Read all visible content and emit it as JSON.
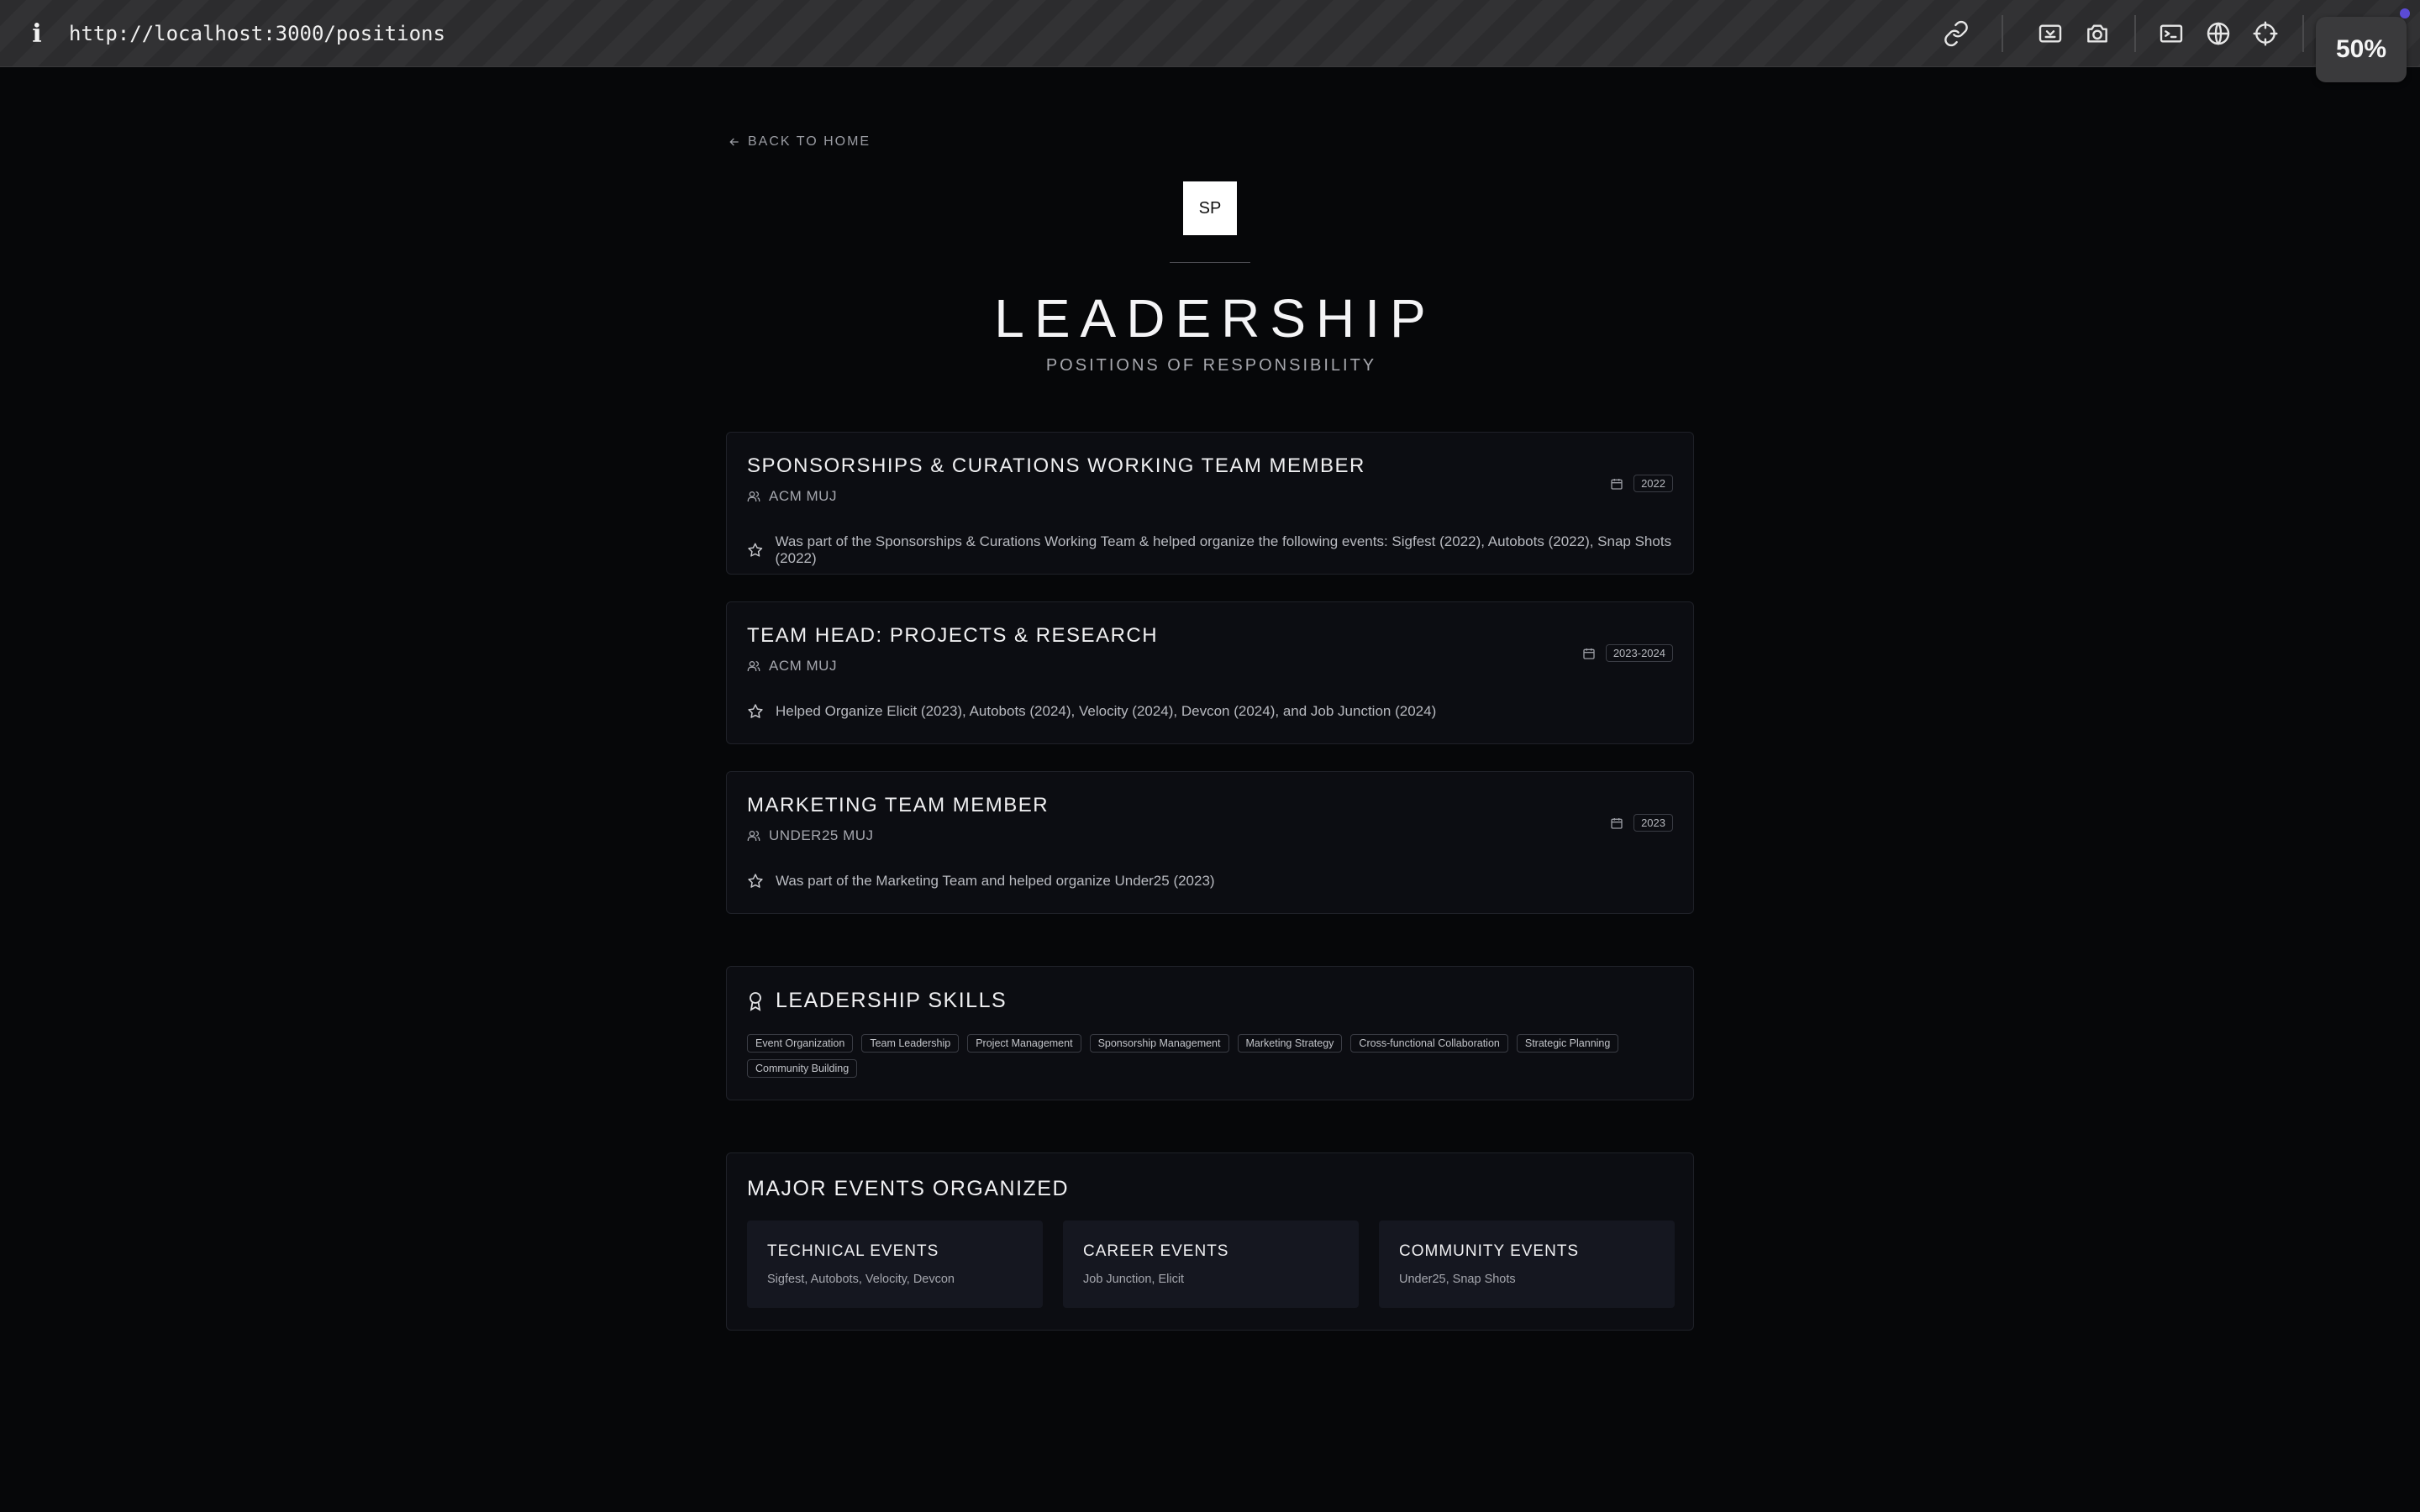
{
  "browser": {
    "url": "http://localhost:3000/positions",
    "zoom": "50%",
    "icons": [
      "link-icon",
      "screenshot-region-icon",
      "camera-icon",
      "terminal-icon",
      "globe-icon",
      "crosshair-icon"
    ]
  },
  "nav": {
    "back_label": "BACK TO HOME"
  },
  "header": {
    "logo_text": "SP",
    "title": "LEADERSHIP",
    "subtitle": "POSITIONS OF RESPONSIBILITY"
  },
  "positions": [
    {
      "title": "SPONSORSHIPS & CURATIONS WORKING TEAM MEMBER",
      "org": "ACM MUJ",
      "date": "2022",
      "description": "Was part of the Sponsorships & Curations Working Team & helped organize the following events: Sigfest (2022), Autobots (2022), Snap Shots (2022)"
    },
    {
      "title": "TEAM HEAD: PROJECTS & RESEARCH",
      "org": "ACM MUJ",
      "date": "2023-2024",
      "description": "Helped Organize Elicit (2023), Autobots (2024), Velocity (2024), Devcon (2024), and Job Junction (2024)"
    },
    {
      "title": "MARKETING TEAM MEMBER",
      "org": "UNDER25 MUJ",
      "date": "2023",
      "description": "Was part of the Marketing Team and helped organize Under25 (2023)"
    }
  ],
  "skills": {
    "title": "LEADERSHIP SKILLS",
    "tags": [
      "Event Organization",
      "Team Leadership",
      "Project Management",
      "Sponsorship Management",
      "Marketing Strategy",
      "Cross-functional Collaboration",
      "Strategic Planning",
      "Community Building"
    ]
  },
  "events": {
    "title": "MAJOR EVENTS ORGANIZED",
    "groups": [
      {
        "name": "TECHNICAL EVENTS",
        "list": "Sigfest, Autobots, Velocity, Devcon"
      },
      {
        "name": "CAREER EVENTS",
        "list": "Job Junction, Elicit"
      },
      {
        "name": "COMMUNITY EVENTS",
        "list": "Under25, Snap Shots"
      }
    ]
  }
}
